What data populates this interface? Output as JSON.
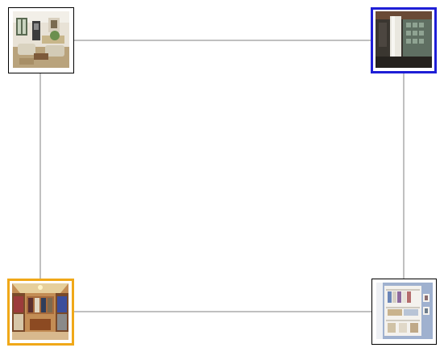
{
  "canvas": {
    "background": "#ffffff",
    "edge_color": "#808080"
  },
  "nodes": [
    {
      "id": "living-room",
      "thumbnail": "living-room-photo",
      "border_color": "#000000",
      "state": "default"
    },
    {
      "id": "basement-room",
      "thumbnail": "basement-room-photo",
      "border_color": "#1f1fd6",
      "state": "selected"
    },
    {
      "id": "walk-in-closet",
      "thumbnail": "walk-in-closet-photo",
      "border_color": "#f0a818",
      "state": "highlighted"
    },
    {
      "id": "reach-in-closet",
      "thumbnail": "reach-in-closet-photo",
      "border_color": "#000000",
      "state": "default"
    }
  ],
  "edges": [
    [
      "living-room",
      "basement-room"
    ],
    [
      "living-room",
      "walk-in-closet"
    ],
    [
      "basement-room",
      "reach-in-closet"
    ],
    [
      "walk-in-closet",
      "reach-in-closet"
    ]
  ]
}
